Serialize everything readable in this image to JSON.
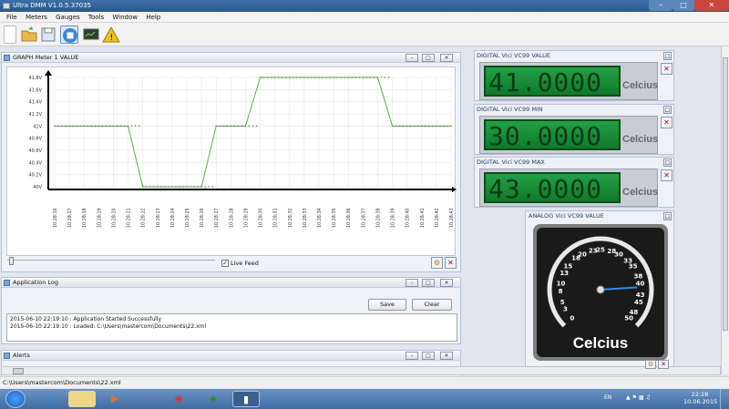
{
  "app": {
    "title": "Ultra DMM V1.0.5.37035"
  },
  "menu": [
    "File",
    "Meters",
    "Gauges",
    "Tools",
    "Window",
    "Help"
  ],
  "toolbar": [
    "new-icon",
    "open-icon",
    "save-icon",
    "stop-icon",
    "monitor-icon",
    "warning-icon"
  ],
  "graph": {
    "title": "GRAPH Meter 1 VALUE",
    "live_feed": "Live Feed",
    "live_checked": true
  },
  "chart_data": {
    "type": "line",
    "x": [
      "10:28:16",
      "10:28:17",
      "10:28:18",
      "10:28:19",
      "10:28:20",
      "10:28:21",
      "10:28:22",
      "10:28:23",
      "10:28:24",
      "10:28:25",
      "10:28:26",
      "10:28:27",
      "10:28:28",
      "10:28:29",
      "10:28:30",
      "10:28:31",
      "10:28:32",
      "10:28:33",
      "10:28:34",
      "10:28:35",
      "10:28:36",
      "10:28:37",
      "10:28:38",
      "10:28:39",
      "10:28:40",
      "10:28:41",
      "10:28:42",
      "10:28:43"
    ],
    "y": [
      41,
      41,
      41,
      41,
      41,
      41,
      40,
      40,
      40,
      40,
      40,
      41,
      41,
      41,
      41.8,
      41.8,
      41.8,
      41.8,
      41.8,
      41.8,
      41.8,
      41.8,
      41.8,
      41,
      41,
      41,
      41,
      41
    ],
    "yticks": [
      "40V",
      "40.2V",
      "40.4V",
      "40.6V",
      "40.8V",
      "41V",
      "41.2V",
      "41.4V",
      "41.6V",
      "41.8V"
    ],
    "ylim": [
      40,
      41.8
    ],
    "line_color": "#5daa4f"
  },
  "log": {
    "title": "Application Log",
    "save": "Save",
    "clear": "Clear",
    "lines": [
      "2015-06-10 22:19:10 : Application Started Successfully",
      "2015-06-10 22:19:10 : Loaded: C:\\Users\\mastercom\\Documents\\22.xml"
    ]
  },
  "alerts": {
    "title": "Alerts"
  },
  "status": {
    "path": "C:\\Users\\mastercom\\Documents\\22.xml"
  },
  "digital": [
    {
      "title": "DIGITAL Vici VC99 VALUE",
      "value": "41.0000",
      "unit": "Celcius"
    },
    {
      "title": "DIGITAL Vici VC99 MIN",
      "value": "30.0000",
      "unit": "Celcius"
    },
    {
      "title": "DIGITAL Vici VC99 MAX",
      "value": "43.0000",
      "unit": "Celcius"
    }
  ],
  "gauge": {
    "title": "ANALOG Vici VC99 VALUE",
    "unit": "Celcius",
    "value": 41,
    "ticks": [
      "0",
      "3",
      "5",
      "8",
      "10",
      "13",
      "15",
      "18",
      "20",
      "23",
      "25",
      "28",
      "30",
      "33",
      "35",
      "38",
      "40",
      "43",
      "45",
      "48",
      "50"
    ],
    "min": 0,
    "max": 50
  },
  "taskbar": {
    "lang": "EN",
    "time": "22:28",
    "date": "10.06.2015"
  }
}
